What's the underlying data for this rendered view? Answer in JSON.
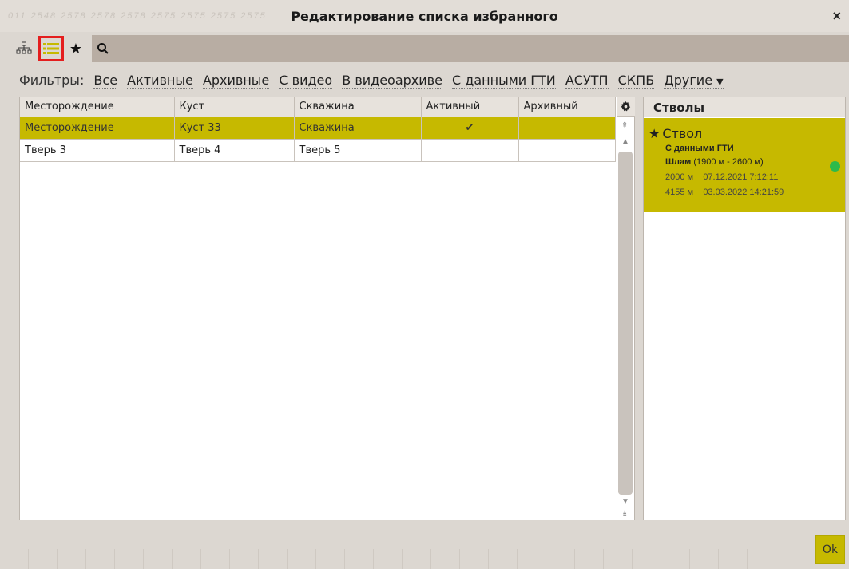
{
  "window": {
    "title": "Редактирование списка избранного",
    "close_label": "×"
  },
  "background_numbers": "011 2548 2578 2578 2578 2575 2575 2575 2575",
  "toolbar": {
    "search_placeholder": ""
  },
  "filters": {
    "label": "Фильтры:",
    "items": [
      "Все",
      "Активные",
      "Архивные",
      "С видео",
      "В видеоархиве",
      "С данными ГТИ",
      "АСУТП",
      "СКПБ",
      "Другие"
    ]
  },
  "table": {
    "headers": [
      "Месторождение",
      "Куст",
      "Скважина",
      "Активный",
      "Архивный"
    ],
    "rows": [
      {
        "field": "Месторождение",
        "bush": "Куст 33",
        "well": "Скважина",
        "active": "✔",
        "archive": ""
      },
      {
        "field": "Тверь 3",
        "bush": "Тверь 4",
        "well": "Тверь 5",
        "active": "",
        "archive": ""
      }
    ]
  },
  "stems": {
    "header": "Стволы",
    "card": {
      "title": "Ствол",
      "subtitle": "С данными ГТИ",
      "sludge_label": "Шлам",
      "sludge_range": " (1900 м - 2600 м)",
      "row1": "2000 м    07.12.2021 7:12:11",
      "row2": "4155 м    03.03.2022 14:21:59",
      "status_color": "#2dba4a"
    }
  },
  "ok_label": "Ok",
  "colors": {
    "accent": "#c6b900",
    "highlight_border": "#e41e1e"
  }
}
